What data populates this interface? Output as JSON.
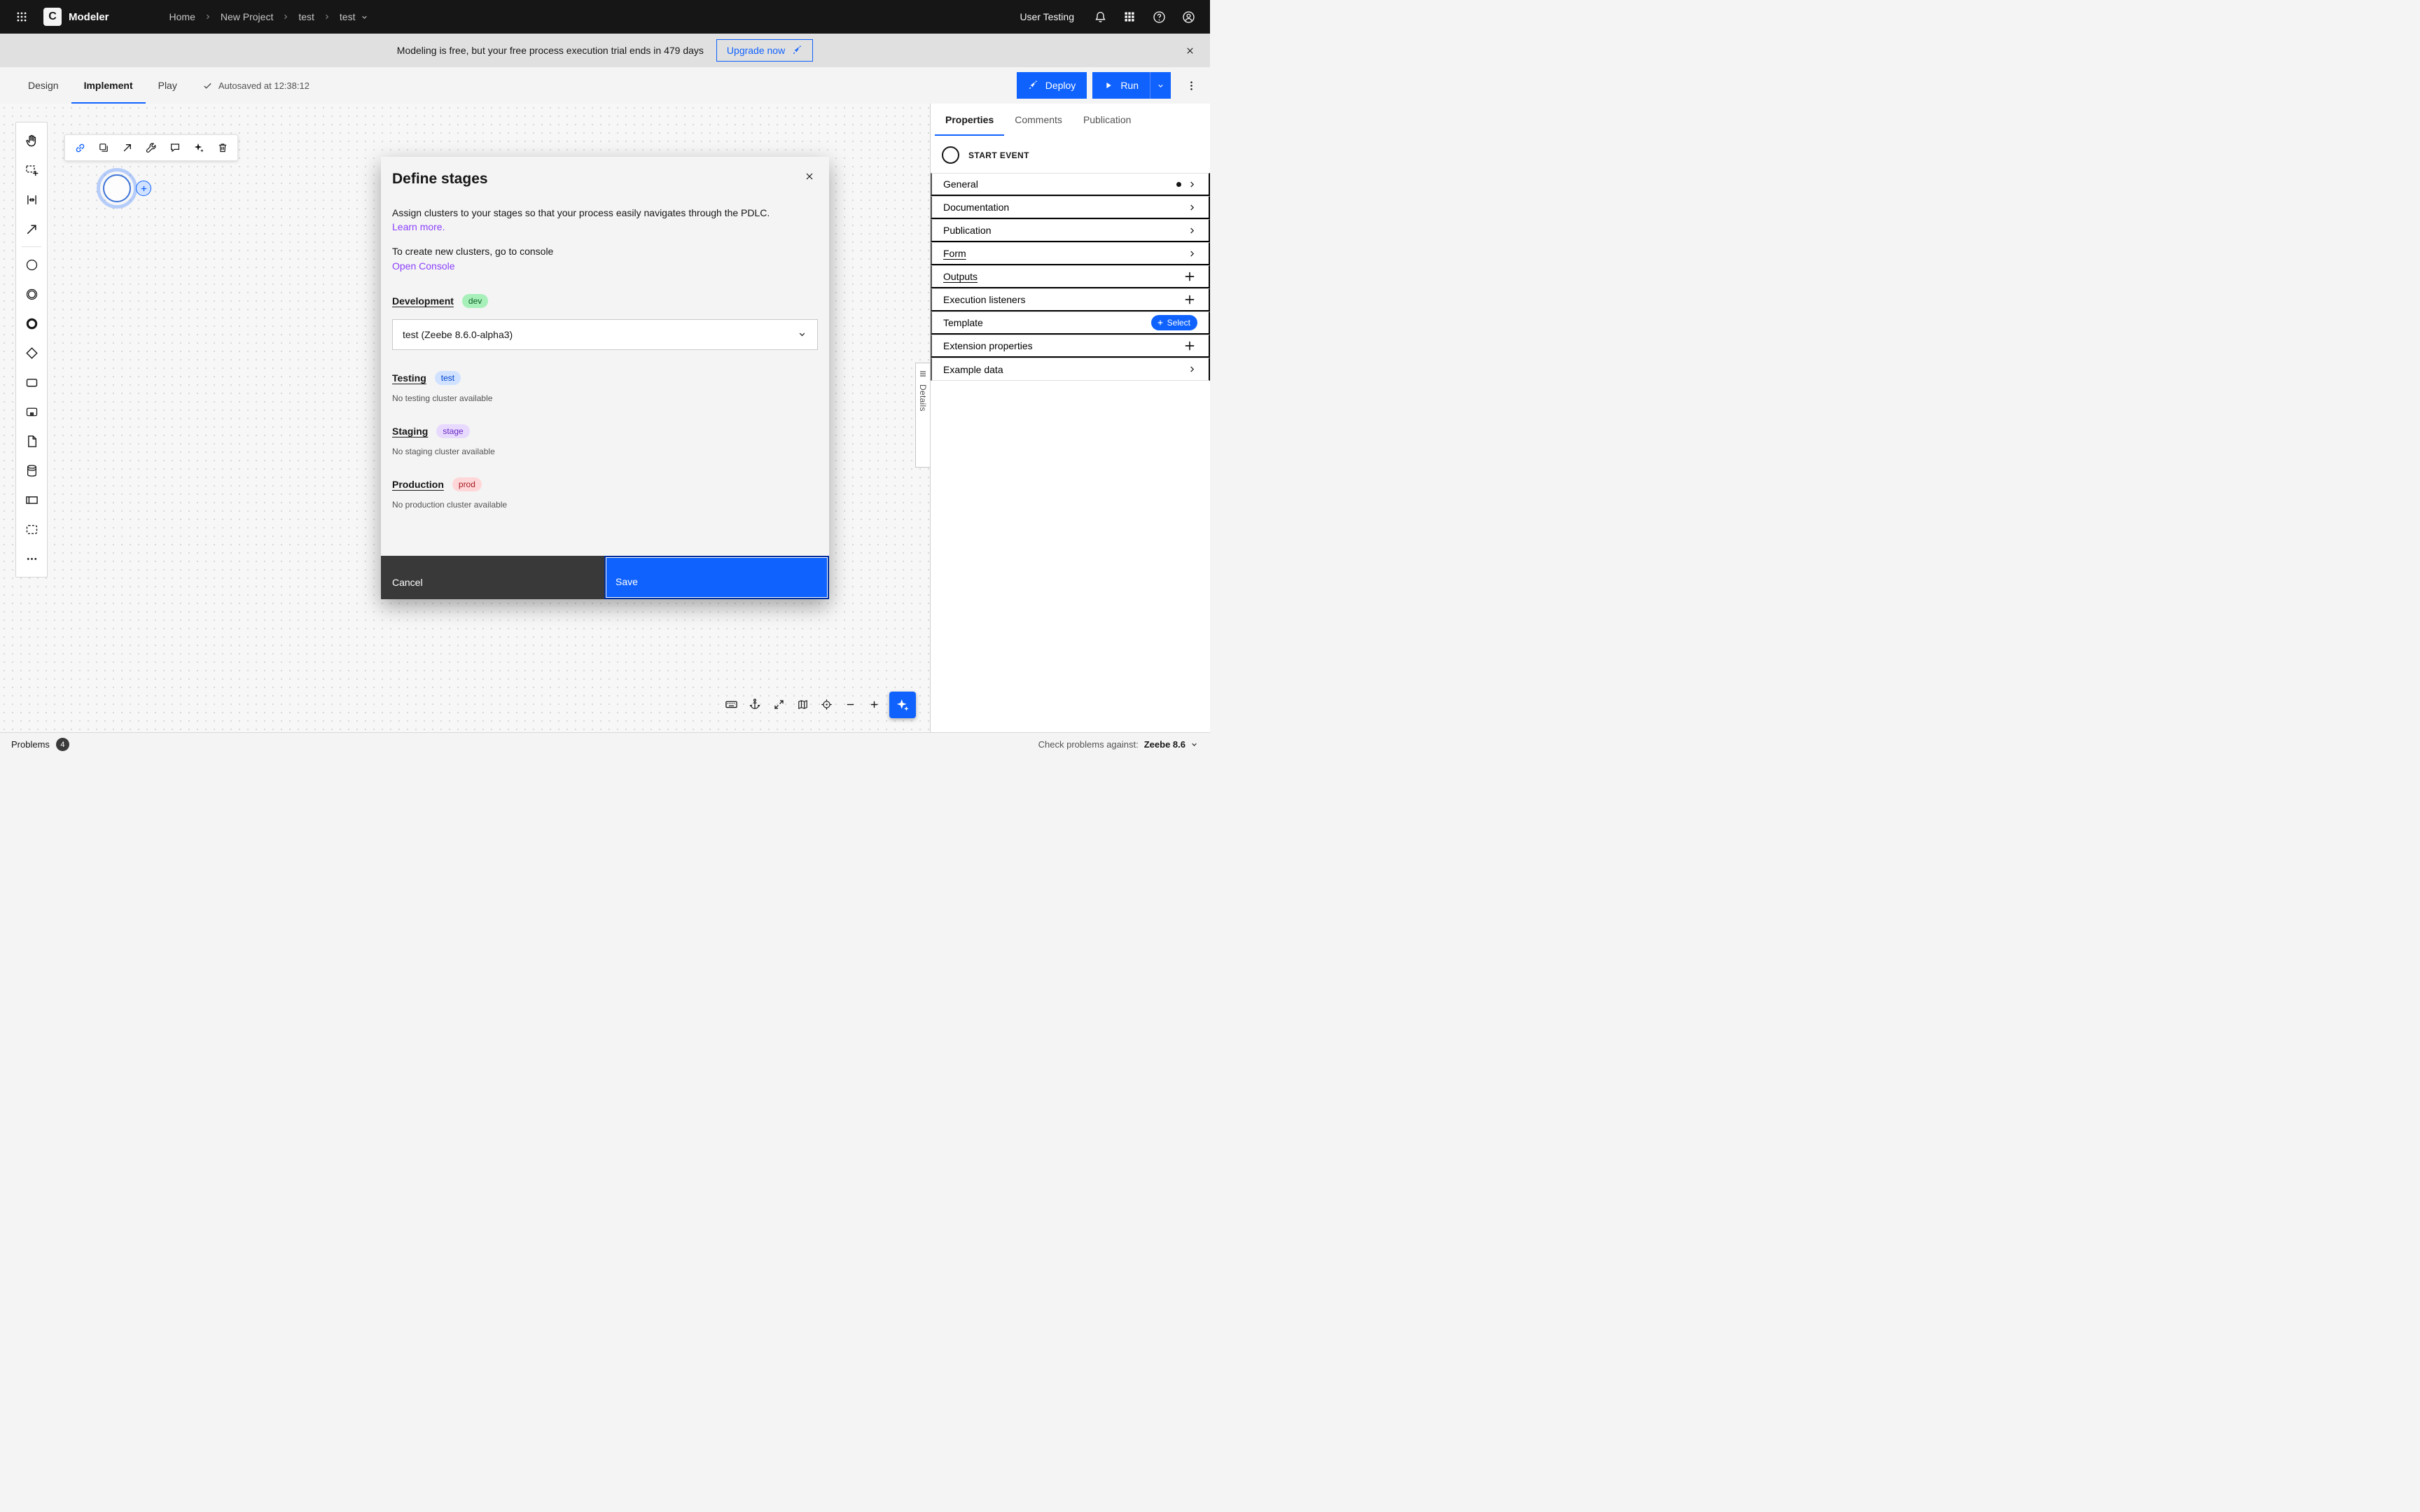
{
  "colors": {
    "accent_blue": "#0f62fe",
    "header_bg": "#161616",
    "link_purple": "#8a3ffc",
    "badge_dev_bg": "#a7f0ba",
    "badge_dev_text": "#0e6027",
    "badge_test_bg": "#d0e2ff",
    "badge_test_text": "#0043ce",
    "badge_stage_bg": "#e8daff",
    "badge_stage_text": "#6929c4",
    "badge_prod_bg": "#ffd7d9",
    "badge_prod_text": "#a2191f"
  },
  "header": {
    "logo_letter": "C",
    "app_name": "Modeler",
    "breadcrumbs": [
      "Home",
      "New Project",
      "test",
      "test"
    ],
    "user_label": "User Testing",
    "icons": [
      "app-switcher-icon",
      "notifications-icon",
      "switcher-icon",
      "help-icon",
      "profile-icon"
    ]
  },
  "banner": {
    "message": "Modeling is free, but your free process execution trial ends in 479 days",
    "upgrade_label": "Upgrade now"
  },
  "toolbar": {
    "tabs": [
      "Design",
      "Implement",
      "Play"
    ],
    "active_tab": "Implement",
    "autosave_text": "Autosaved at 12:38:12",
    "deploy_label": "Deploy",
    "run_label": "Run"
  },
  "canvas": {
    "palette_tools": [
      "hand-tool",
      "lasso-tool",
      "space-tool",
      "global-connect-tool",
      "create-start-event",
      "create-intermediate-event",
      "create-end-event",
      "create-gateway",
      "create-task",
      "create-subprocess",
      "create-data-object",
      "create-data-store",
      "create-participant",
      "create-group",
      "more-tools"
    ],
    "context_pad_icons": [
      "link-icon",
      "copy-icon",
      "connect-arrow-icon",
      "wrench-icon",
      "comment-icon",
      "sparkle-icon",
      "trash-icon"
    ],
    "view_control_icons": [
      "keyboard-icon",
      "anchor-icon",
      "fullscreen-icon",
      "minimap-icon",
      "reset-zoom-icon",
      "zoom-out-icon",
      "zoom-in-icon",
      "ai-sparkle-icon"
    ]
  },
  "modal": {
    "title": "Define stages",
    "description": "Assign clusters to your stages so that your process easily navigates through the PDLC.",
    "learn_more_label": "Learn more.",
    "console_hint": "To create new clusters, go to console",
    "open_console_label": "Open Console",
    "stages": [
      {
        "name": "Development",
        "badge": "dev",
        "cluster": "test (Zeebe 8.6.0-alpha3)"
      },
      {
        "name": "Testing",
        "badge": "test",
        "empty_text": "No testing cluster available"
      },
      {
        "name": "Staging",
        "badge": "stage",
        "empty_text": "No staging cluster available"
      },
      {
        "name": "Production",
        "badge": "prod",
        "empty_text": "No production cluster available"
      }
    ],
    "cancel_label": "Cancel",
    "save_label": "Save"
  },
  "properties_panel": {
    "tabs": [
      "Properties",
      "Comments",
      "Publication"
    ],
    "active_tab": "Properties",
    "element_type_label": "START EVENT",
    "groups": [
      {
        "label": "General"
      },
      {
        "label": "Documentation"
      },
      {
        "label": "Publication"
      },
      {
        "label": "Form"
      },
      {
        "label": "Outputs"
      },
      {
        "label": "Execution listeners"
      },
      {
        "label": "Template"
      },
      {
        "label": "Extension properties"
      },
      {
        "label": "Example data"
      }
    ],
    "template_select_label": "Select",
    "details_tab_label": "Details"
  },
  "statusbar": {
    "problems_label": "Problems",
    "problems_count": "4",
    "check_label": "Check problems against:",
    "engine_label": "Zeebe 8.6"
  }
}
